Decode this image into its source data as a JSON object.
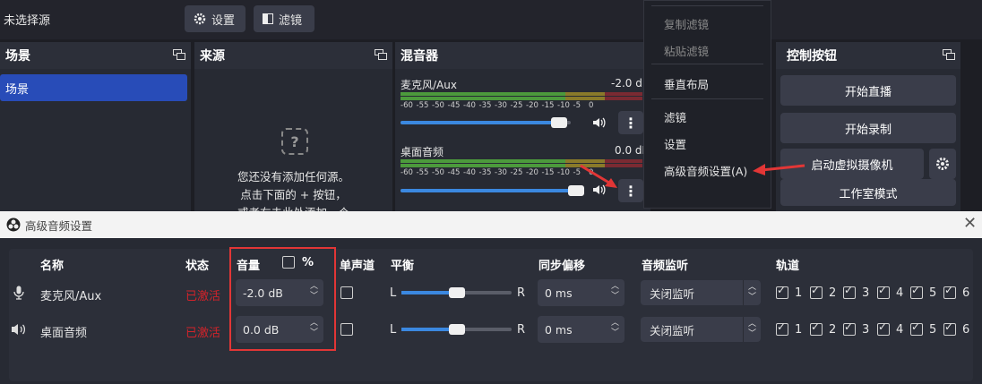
{
  "toolbar": {
    "source_none": "未选择源",
    "settings_label": "设置",
    "filters_label": "滤镜"
  },
  "scenes": {
    "title": "场景",
    "items": [
      "场景"
    ]
  },
  "sources": {
    "title": "来源",
    "empty_line1": "您还没有添加任何源。",
    "empty_line2": "点击下面的 + 按钮，",
    "empty_line3": "或者右击此处添加一个"
  },
  "mixer": {
    "title": "混音器",
    "ticks": [
      "-60",
      "-55",
      "-50",
      "-45",
      "-40",
      "-35",
      "-30",
      "-25",
      "-20",
      "-15",
      "-10",
      "-5",
      "0"
    ],
    "channels": [
      {
        "name": "麦克风/Aux",
        "db": "-2.0 dB",
        "volume_fraction": 0.9
      },
      {
        "name": "桌面音频",
        "db": "0.0 dB",
        "volume_fraction": 1.0
      }
    ]
  },
  "context_menu": {
    "items": [
      "复制滤镜",
      "粘贴滤镜",
      "垂直布局",
      "滤镜",
      "设置",
      "高级音频设置(A)"
    ]
  },
  "controls": {
    "title": "控制按钮",
    "start_stream": "开始直播",
    "start_record": "开始录制",
    "virtual_cam": "启动虚拟摄像机",
    "studio_mode": "工作室模式"
  },
  "dialog": {
    "title": "高级音频设置",
    "headers": {
      "name": "名称",
      "status": "状态",
      "volume": "音量",
      "percent": "%",
      "mono": "单声道",
      "balance": "平衡",
      "sync": "同步偏移",
      "monitor": "音频监听",
      "tracks": "轨道"
    },
    "balance_left": "L",
    "balance_right": "R",
    "rows": [
      {
        "icon": "microphone-icon",
        "name": "麦克风/Aux",
        "status": "已激活",
        "volume": "-2.0 dB",
        "balance_fraction": 0.5,
        "sync": "0 ms",
        "monitor": "关闭监听",
        "tracks": [
          "1",
          "2",
          "3",
          "4",
          "5",
          "6"
        ]
      },
      {
        "icon": "speaker-icon",
        "name": "桌面音频",
        "status": "已激活",
        "volume": "0.0 dB",
        "balance_fraction": 0.5,
        "sync": "0 ms",
        "monitor": "关闭监听",
        "tracks": [
          "1",
          "2",
          "3",
          "4",
          "5",
          "6"
        ]
      }
    ]
  },
  "colors": {
    "accent": "#3b88e0",
    "selection": "#284cb8",
    "highlight": "#e23636",
    "status_active": "#d2232a"
  }
}
